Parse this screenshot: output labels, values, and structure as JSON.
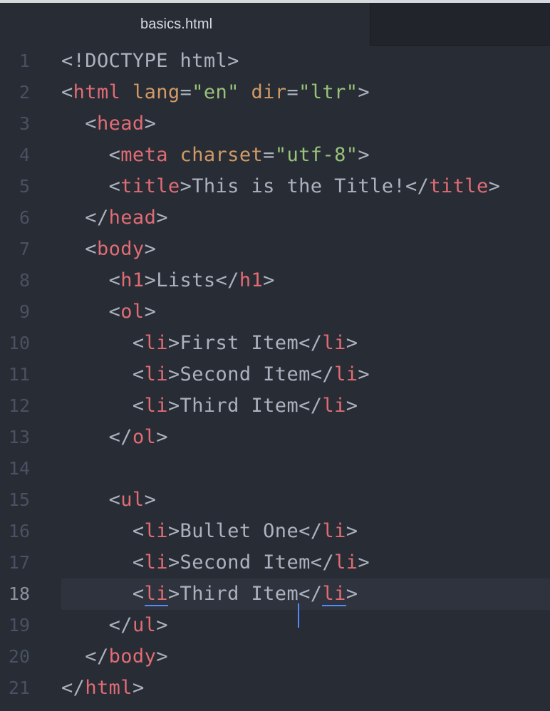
{
  "tab": {
    "title": "basics.html"
  },
  "colors": {
    "background": "#282c34",
    "tag": "#e06c75",
    "attribute": "#d19a66",
    "string": "#98c379",
    "text": "#abb2bf",
    "line_number": "#495162",
    "cursor": "#528bff"
  },
  "editor": {
    "active_line": 18,
    "lines": [
      {
        "n": "1",
        "tokens": [
          {
            "t": "<!DOCTYPE html>",
            "c": "txtc"
          }
        ]
      },
      {
        "n": "2",
        "tokens": [
          {
            "t": "<",
            "c": "punct"
          },
          {
            "t": "html",
            "c": "tag-name"
          },
          {
            "t": " ",
            "c": "punct"
          },
          {
            "t": "lang",
            "c": "attr"
          },
          {
            "t": "=",
            "c": "punct"
          },
          {
            "t": "\"en\"",
            "c": "str"
          },
          {
            "t": " ",
            "c": "punct"
          },
          {
            "t": "dir",
            "c": "attr"
          },
          {
            "t": "=",
            "c": "punct"
          },
          {
            "t": "\"ltr\"",
            "c": "str"
          },
          {
            "t": ">",
            "c": "punct"
          }
        ]
      },
      {
        "n": "3",
        "tokens": [
          {
            "t": "  <",
            "c": "punct"
          },
          {
            "t": "head",
            "c": "tag-name"
          },
          {
            "t": ">",
            "c": "punct"
          }
        ]
      },
      {
        "n": "4",
        "tokens": [
          {
            "t": "    <",
            "c": "punct"
          },
          {
            "t": "meta",
            "c": "tag-name"
          },
          {
            "t": " ",
            "c": "punct"
          },
          {
            "t": "charset",
            "c": "attr"
          },
          {
            "t": "=",
            "c": "punct"
          },
          {
            "t": "\"utf-8\"",
            "c": "str"
          },
          {
            "t": ">",
            "c": "punct"
          }
        ]
      },
      {
        "n": "5",
        "tokens": [
          {
            "t": "    <",
            "c": "punct"
          },
          {
            "t": "title",
            "c": "tag-name"
          },
          {
            "t": ">This is the Title!</",
            "c": "punct"
          },
          {
            "t": "title",
            "c": "tag-name"
          },
          {
            "t": ">",
            "c": "punct"
          }
        ]
      },
      {
        "n": "6",
        "tokens": [
          {
            "t": "  </",
            "c": "punct"
          },
          {
            "t": "head",
            "c": "tag-name"
          },
          {
            "t": ">",
            "c": "punct"
          }
        ]
      },
      {
        "n": "7",
        "tokens": [
          {
            "t": "  <",
            "c": "punct"
          },
          {
            "t": "body",
            "c": "tag-name"
          },
          {
            "t": ">",
            "c": "punct"
          }
        ]
      },
      {
        "n": "8",
        "tokens": [
          {
            "t": "    <",
            "c": "punct"
          },
          {
            "t": "h1",
            "c": "tag-name"
          },
          {
            "t": ">Lists</",
            "c": "punct"
          },
          {
            "t": "h1",
            "c": "tag-name"
          },
          {
            "t": ">",
            "c": "punct"
          }
        ]
      },
      {
        "n": "9",
        "tokens": [
          {
            "t": "    <",
            "c": "punct"
          },
          {
            "t": "ol",
            "c": "tag-name"
          },
          {
            "t": ">",
            "c": "punct"
          }
        ]
      },
      {
        "n": "10",
        "tokens": [
          {
            "t": "      <",
            "c": "punct"
          },
          {
            "t": "li",
            "c": "tag-name"
          },
          {
            "t": ">First Item</",
            "c": "punct"
          },
          {
            "t": "li",
            "c": "tag-name"
          },
          {
            "t": ">",
            "c": "punct"
          }
        ]
      },
      {
        "n": "11",
        "tokens": [
          {
            "t": "      <",
            "c": "punct"
          },
          {
            "t": "li",
            "c": "tag-name"
          },
          {
            "t": ">Second Item</",
            "c": "punct"
          },
          {
            "t": "li",
            "c": "tag-name"
          },
          {
            "t": ">",
            "c": "punct"
          }
        ]
      },
      {
        "n": "12",
        "tokens": [
          {
            "t": "      <",
            "c": "punct"
          },
          {
            "t": "li",
            "c": "tag-name"
          },
          {
            "t": ">Third Item</",
            "c": "punct"
          },
          {
            "t": "li",
            "c": "tag-name"
          },
          {
            "t": ">",
            "c": "punct"
          }
        ]
      },
      {
        "n": "13",
        "tokens": [
          {
            "t": "    </",
            "c": "punct"
          },
          {
            "t": "ol",
            "c": "tag-name"
          },
          {
            "t": ">",
            "c": "punct"
          }
        ]
      },
      {
        "n": "14",
        "tokens": []
      },
      {
        "n": "15",
        "tokens": [
          {
            "t": "    <",
            "c": "punct"
          },
          {
            "t": "ul",
            "c": "tag-name"
          },
          {
            "t": ">",
            "c": "punct"
          }
        ]
      },
      {
        "n": "16",
        "tokens": [
          {
            "t": "      <",
            "c": "punct"
          },
          {
            "t": "li",
            "c": "tag-name"
          },
          {
            "t": ">Bullet One</",
            "c": "punct"
          },
          {
            "t": "li",
            "c": "tag-name"
          },
          {
            "t": ">",
            "c": "punct"
          }
        ]
      },
      {
        "n": "17",
        "tokens": [
          {
            "t": "      <",
            "c": "punct"
          },
          {
            "t": "li",
            "c": "tag-name"
          },
          {
            "t": ">Second Item</",
            "c": "punct"
          },
          {
            "t": "li",
            "c": "tag-name"
          },
          {
            "t": ">",
            "c": "punct"
          }
        ]
      },
      {
        "n": "18",
        "tokens": [
          {
            "t": "      <",
            "c": "punct"
          },
          {
            "t": "li",
            "c": "tag-name",
            "mark": true
          },
          {
            "t": ">Third Item",
            "c": "punct"
          },
          {
            "t": "|CURSOR|",
            "c": "cursor"
          },
          {
            "t": "</",
            "c": "punct"
          },
          {
            "t": "li",
            "c": "tag-name",
            "mark": true
          },
          {
            "t": ">",
            "c": "punct"
          }
        ]
      },
      {
        "n": "19",
        "tokens": [
          {
            "t": "    </",
            "c": "punct"
          },
          {
            "t": "ul",
            "c": "tag-name"
          },
          {
            "t": ">",
            "c": "punct"
          }
        ]
      },
      {
        "n": "20",
        "tokens": [
          {
            "t": "  </",
            "c": "punct"
          },
          {
            "t": "body",
            "c": "tag-name"
          },
          {
            "t": ">",
            "c": "punct"
          }
        ]
      },
      {
        "n": "21",
        "tokens": [
          {
            "t": "</",
            "c": "punct"
          },
          {
            "t": "html",
            "c": "tag-name"
          },
          {
            "t": ">",
            "c": "punct"
          }
        ]
      }
    ]
  }
}
